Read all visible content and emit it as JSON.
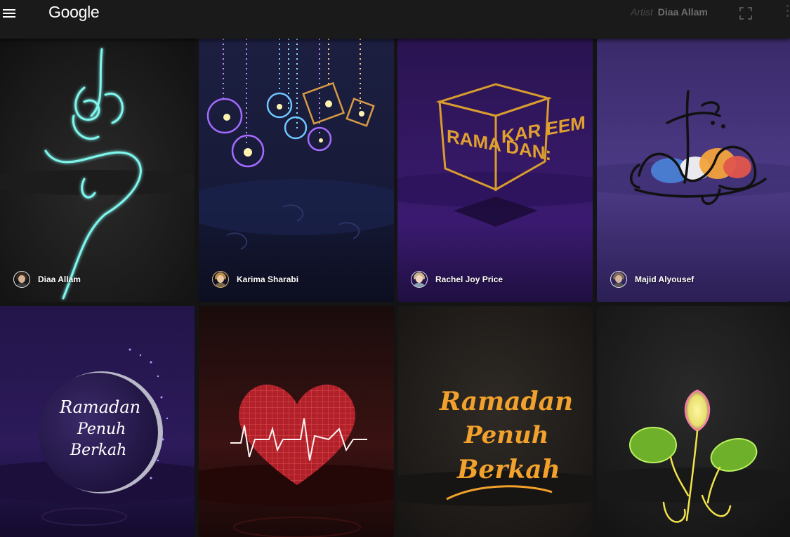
{
  "header": {
    "logo": "Google",
    "artist_label": "Artist",
    "artist_name": "Diaa Allam",
    "icons": [
      "menu-icon",
      "fullscreen-icon",
      "more-vert-icon"
    ]
  },
  "tiles": [
    {
      "artist": "Diaa Allam",
      "art": "glowing cyan Arabic calligraphy",
      "accent": "#5ef2e6"
    },
    {
      "artist": "Karima Sharabi",
      "art": "hanging purple and gold lanterns",
      "accent": "#c08cff"
    },
    {
      "artist": "Rachel Joy Price",
      "art": "golden lettered cube",
      "accent": "#e0a030"
    },
    {
      "artist": "Majid Alyousef",
      "art": "colorful calligraphy",
      "accent": "#2d2d2d"
    },
    {
      "artist": "",
      "art": "crescent moon with script",
      "accent": "#ffffff"
    },
    {
      "artist": "",
      "art": "red heartbeat heart",
      "accent": "#ff3b45"
    },
    {
      "artist": "",
      "art": "golden script lettering",
      "accent": "#f2a22c"
    },
    {
      "artist": "",
      "art": "glowing lantern with leaves",
      "accent": "#a8e04a"
    }
  ],
  "cube_letters": {
    "left": "RAMA DAN:",
    "right": "KAR EEM"
  },
  "moon_script": [
    "Ramadan",
    "Penuh",
    "Berkah"
  ],
  "gold_script": [
    "Ramadan",
    "Penuh",
    "Berkah"
  ]
}
